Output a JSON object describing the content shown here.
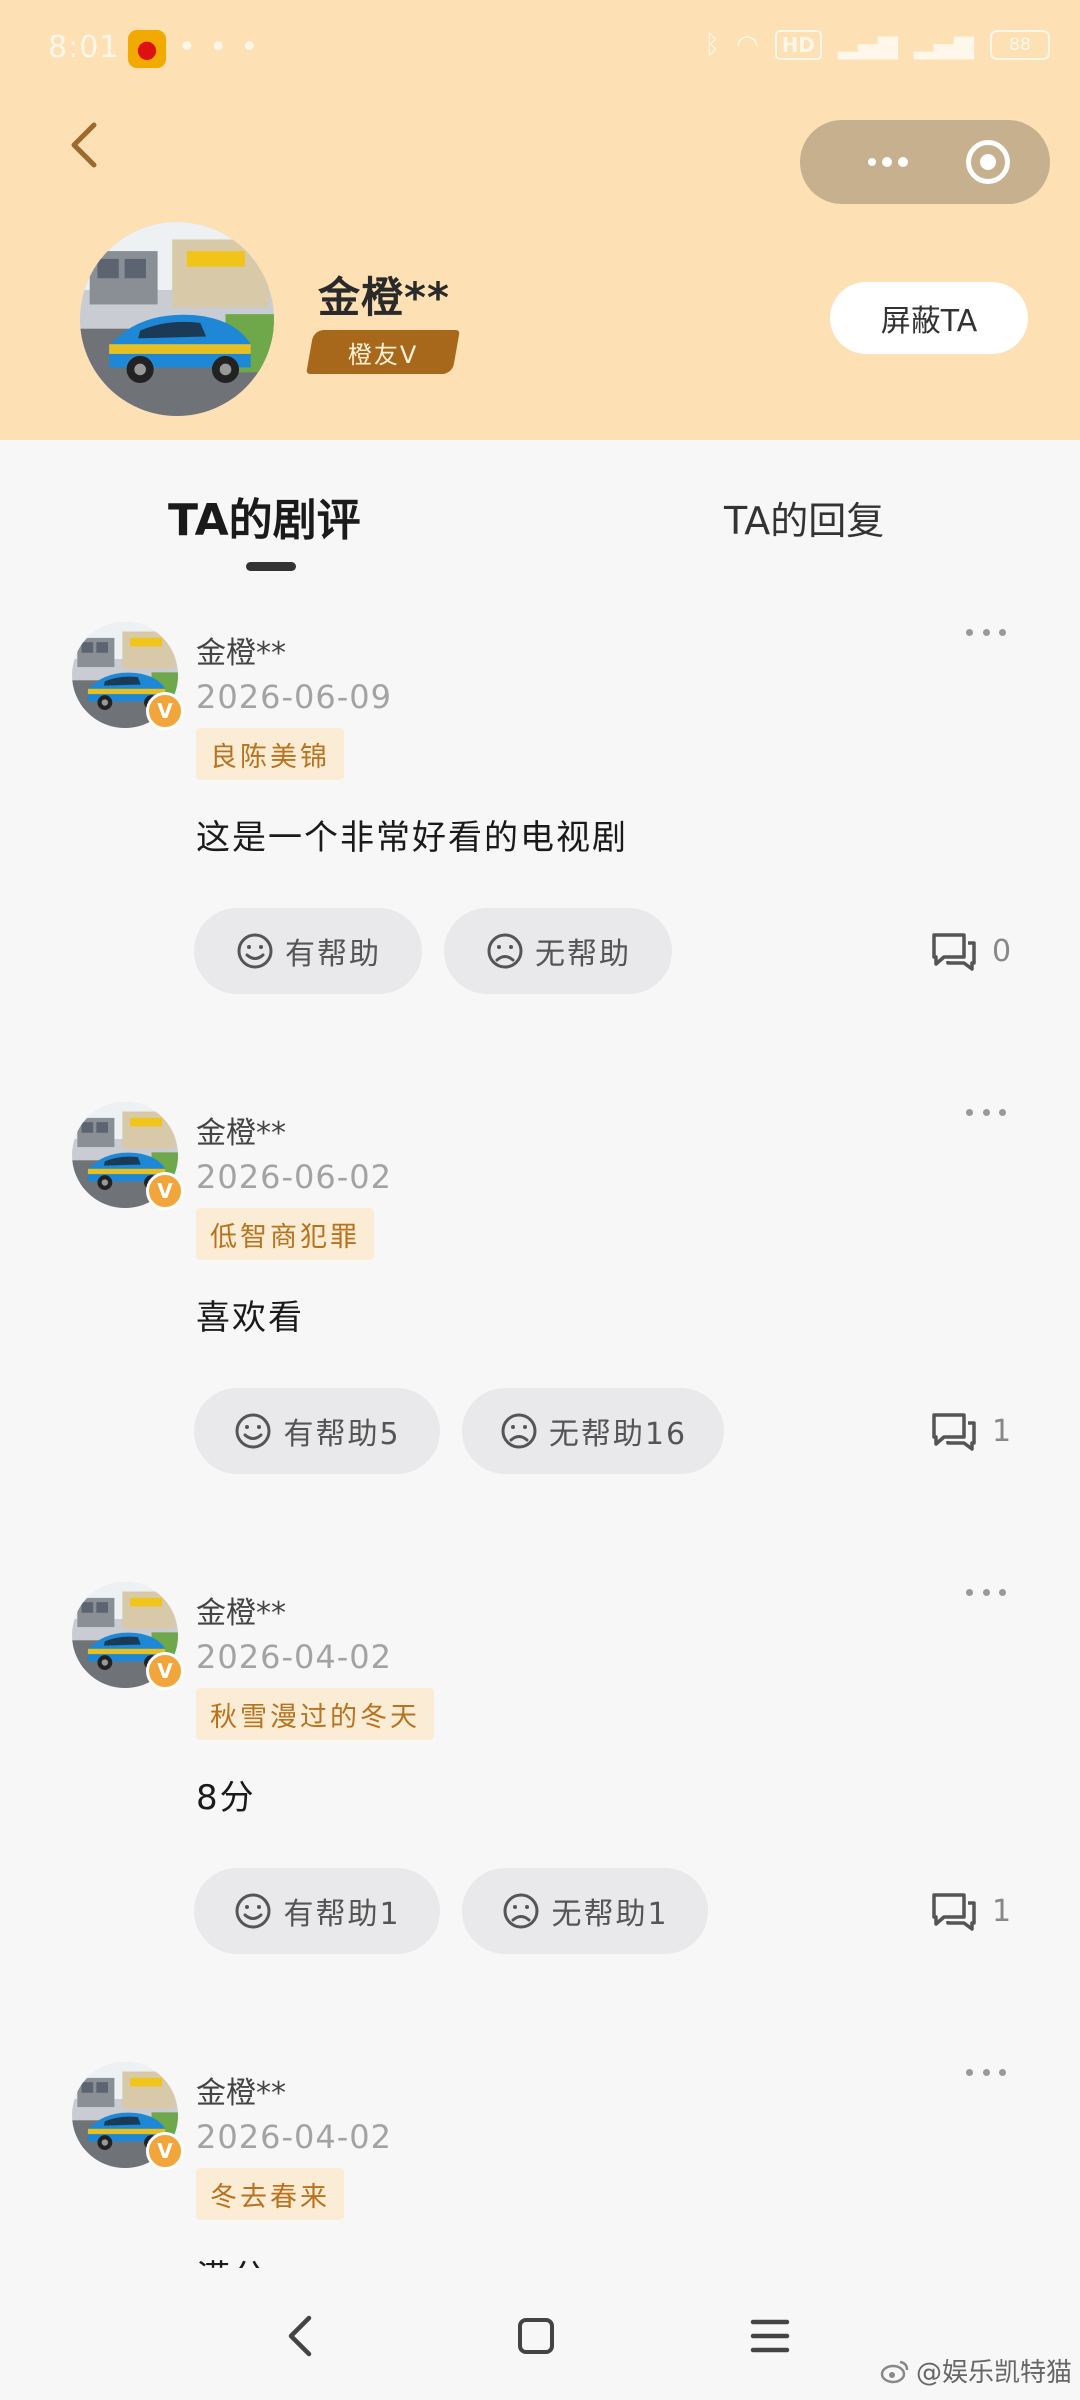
{
  "status_bar": {
    "time": "8:01",
    "notification_dots": "• • •",
    "network_badge": "HD",
    "battery": "88"
  },
  "profile": {
    "name": "金橙**",
    "badge": "橙友V",
    "block_label": "屏蔽TA"
  },
  "tabs": [
    {
      "label": "TA的剧评",
      "active": true
    },
    {
      "label": "TA的回复",
      "active": false
    }
  ],
  "reviews": [
    {
      "user": "金橙**",
      "date": "2026-06-09",
      "show": "良陈美锦",
      "text": "这是一个非常好看的电视剧",
      "helpful": "有帮助",
      "unhelpful": "无帮助",
      "comments": "0"
    },
    {
      "user": "金橙**",
      "date": "2026-06-02",
      "show": "低智商犯罪",
      "text": "喜欢看",
      "helpful": "有帮助5",
      "unhelpful": "无帮助16",
      "comments": "1"
    },
    {
      "user": "金橙**",
      "date": "2026-04-02",
      "show": "秋雪漫过的冬天",
      "text": "8分",
      "helpful": "有帮助1",
      "unhelpful": "无帮助1",
      "comments": "1"
    },
    {
      "user": "金橙**",
      "date": "2026-04-02",
      "show": "冬去春来",
      "text": "满分"
    }
  ],
  "avatar_v_mark": "V",
  "watermark": "@娱乐凯特猫",
  "colors": {
    "header_bg": "#fde0b4",
    "badge_brown": "#a8681b",
    "show_tag_bg": "#fbecd5",
    "show_tag_text": "#b9731f",
    "pill_bg": "#e9e9eb",
    "v_badge": "#f2a53a"
  },
  "icons": [
    "back-arrow-icon",
    "more-dots-icon",
    "target-icon",
    "smile-icon",
    "frown-icon",
    "comment-icon",
    "nav-back-icon",
    "nav-home-icon",
    "nav-menu-icon"
  ]
}
